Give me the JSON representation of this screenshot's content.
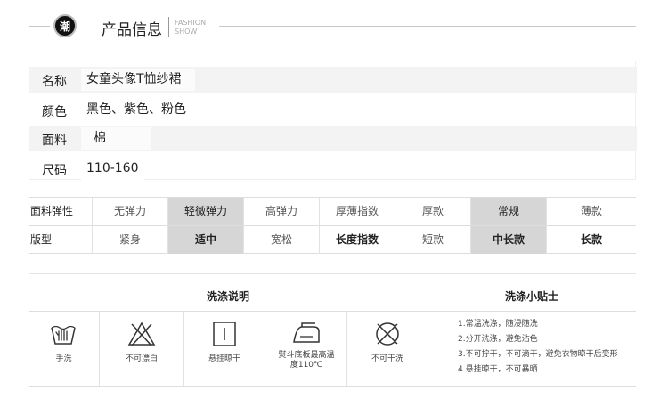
{
  "header": {
    "badge": "潮",
    "title": "产品信息",
    "en_line1": "FASHION",
    "en_line2": "SHOW"
  },
  "info": [
    {
      "label": "名称",
      "value": "女童头像T恤纱裙"
    },
    {
      "label": "颜色",
      "value": "黑色、紫色、粉色"
    },
    {
      "label": "面料",
      "value": "棉"
    },
    {
      "label": "尺码",
      "value": "110-160"
    }
  ],
  "attributes": {
    "row1": {
      "label": "面料弹性",
      "cells": [
        "无弹力",
        "轻微弹力",
        "高弹力",
        "厚薄指数",
        "厚款",
        "常规",
        "薄款"
      ]
    },
    "row2": {
      "label": "版型",
      "cells": [
        "紧身",
        "适中",
        "宽松",
        "长度指数",
        "短款",
        "中长款",
        "长款"
      ]
    }
  },
  "washing": {
    "heading": "洗涤说明",
    "items": [
      {
        "icon": "hand-wash-icon",
        "label": "手洗"
      },
      {
        "icon": "no-bleach-icon",
        "label": "不可漂白"
      },
      {
        "icon": "hang-dry-icon",
        "label": "悬挂晾干"
      },
      {
        "icon": "iron-icon",
        "label": "熨斗底板最高温度110℃"
      },
      {
        "icon": "no-tumble-dry-icon",
        "label": "不可干洗"
      }
    ]
  },
  "tips": {
    "heading": "洗涤小贴士",
    "items": [
      "1.常温洗涤，随浸随洗",
      "2.分开洗涤，避免沾色",
      "3.不可拧干，不可滴干，避免衣物晾干后变形",
      "4.悬挂晾干，不可暴晒"
    ]
  }
}
